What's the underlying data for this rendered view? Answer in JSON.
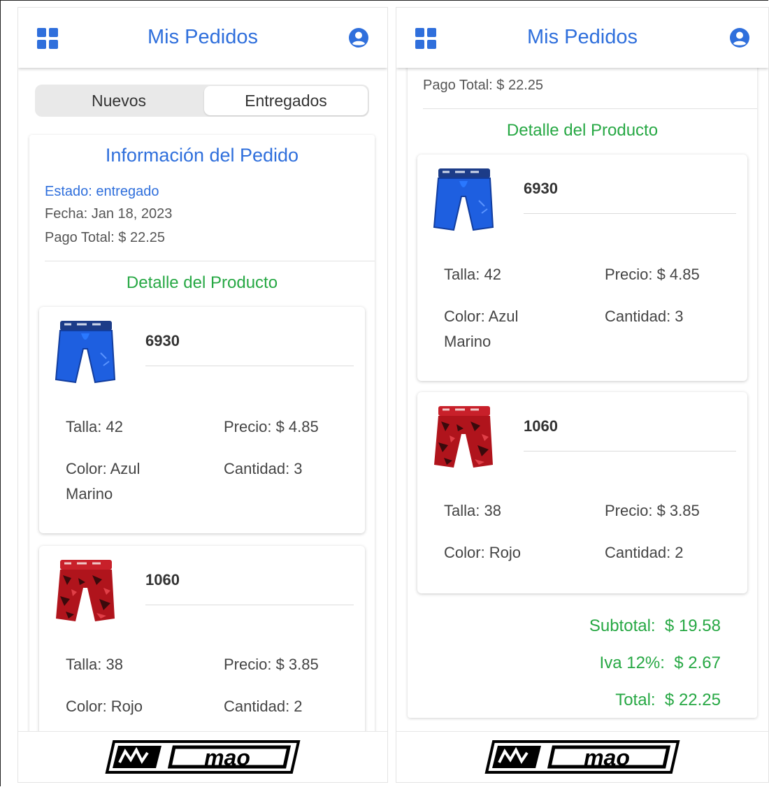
{
  "appbar": {
    "title": "Mis Pedidos",
    "left_icon": "grid-icon",
    "right_icon": "account-circle-icon"
  },
  "tabs": [
    {
      "label": "Nuevos",
      "selected": false
    },
    {
      "label": "Entregados",
      "selected": true
    }
  ],
  "order": {
    "title": "Información del Pedido",
    "status": "Estado: entregado",
    "date": "Fecha: Jan 18, 2023",
    "payment": "Pago Total: $ 22.25",
    "detail_title": "Detalle del Producto"
  },
  "products": [
    {
      "code": "6930",
      "image": "blue-boxer-brief-image",
      "size": "Talla: 42",
      "price": "Precio: $ 4.85",
      "color_line1": "Color: Azul",
      "color_line2": "Marino",
      "quantity": "Cantidad: 3"
    },
    {
      "code": "1060",
      "image": "red-camo-boxer-brief-image",
      "size": "Talla: 38",
      "price": "Precio: $ 3.85",
      "color_line1": "Color: Rojo",
      "color_line2": "",
      "quantity": "Cantidad: 2"
    }
  ],
  "totals": {
    "subtotal_label": "Subtotal:",
    "subtotal_value": "$ 19.58",
    "iva_label": "Iva 12%:",
    "iva_value": "$ 2.67",
    "total_label": "Total:",
    "total_value": "$ 22.25"
  },
  "footer": {
    "logo": "mao-brand-logo",
    "logo_text": "MAO"
  },
  "colors": {
    "primary_blue": "#2f6fdc",
    "green": "#27a844"
  }
}
